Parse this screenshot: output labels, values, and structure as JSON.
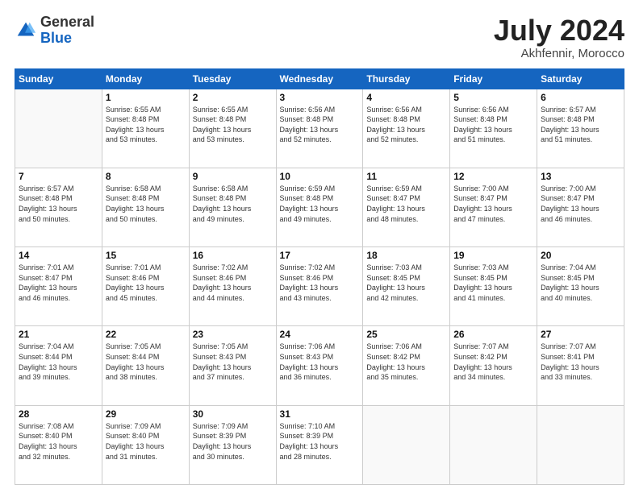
{
  "logo": {
    "general": "General",
    "blue": "Blue"
  },
  "header": {
    "month": "July 2024",
    "location": "Akhfennir, Morocco"
  },
  "days_of_week": [
    "Sunday",
    "Monday",
    "Tuesday",
    "Wednesday",
    "Thursday",
    "Friday",
    "Saturday"
  ],
  "weeks": [
    [
      {
        "day": "",
        "info": ""
      },
      {
        "day": "1",
        "info": "Sunrise: 6:55 AM\nSunset: 8:48 PM\nDaylight: 13 hours\nand 53 minutes."
      },
      {
        "day": "2",
        "info": "Sunrise: 6:55 AM\nSunset: 8:48 PM\nDaylight: 13 hours\nand 53 minutes."
      },
      {
        "day": "3",
        "info": "Sunrise: 6:56 AM\nSunset: 8:48 PM\nDaylight: 13 hours\nand 52 minutes."
      },
      {
        "day": "4",
        "info": "Sunrise: 6:56 AM\nSunset: 8:48 PM\nDaylight: 13 hours\nand 52 minutes."
      },
      {
        "day": "5",
        "info": "Sunrise: 6:56 AM\nSunset: 8:48 PM\nDaylight: 13 hours\nand 51 minutes."
      },
      {
        "day": "6",
        "info": "Sunrise: 6:57 AM\nSunset: 8:48 PM\nDaylight: 13 hours\nand 51 minutes."
      }
    ],
    [
      {
        "day": "7",
        "info": "Sunrise: 6:57 AM\nSunset: 8:48 PM\nDaylight: 13 hours\nand 50 minutes."
      },
      {
        "day": "8",
        "info": "Sunrise: 6:58 AM\nSunset: 8:48 PM\nDaylight: 13 hours\nand 50 minutes."
      },
      {
        "day": "9",
        "info": "Sunrise: 6:58 AM\nSunset: 8:48 PM\nDaylight: 13 hours\nand 49 minutes."
      },
      {
        "day": "10",
        "info": "Sunrise: 6:59 AM\nSunset: 8:48 PM\nDaylight: 13 hours\nand 49 minutes."
      },
      {
        "day": "11",
        "info": "Sunrise: 6:59 AM\nSunset: 8:47 PM\nDaylight: 13 hours\nand 48 minutes."
      },
      {
        "day": "12",
        "info": "Sunrise: 7:00 AM\nSunset: 8:47 PM\nDaylight: 13 hours\nand 47 minutes."
      },
      {
        "day": "13",
        "info": "Sunrise: 7:00 AM\nSunset: 8:47 PM\nDaylight: 13 hours\nand 46 minutes."
      }
    ],
    [
      {
        "day": "14",
        "info": "Sunrise: 7:01 AM\nSunset: 8:47 PM\nDaylight: 13 hours\nand 46 minutes."
      },
      {
        "day": "15",
        "info": "Sunrise: 7:01 AM\nSunset: 8:46 PM\nDaylight: 13 hours\nand 45 minutes."
      },
      {
        "day": "16",
        "info": "Sunrise: 7:02 AM\nSunset: 8:46 PM\nDaylight: 13 hours\nand 44 minutes."
      },
      {
        "day": "17",
        "info": "Sunrise: 7:02 AM\nSunset: 8:46 PM\nDaylight: 13 hours\nand 43 minutes."
      },
      {
        "day": "18",
        "info": "Sunrise: 7:03 AM\nSunset: 8:45 PM\nDaylight: 13 hours\nand 42 minutes."
      },
      {
        "day": "19",
        "info": "Sunrise: 7:03 AM\nSunset: 8:45 PM\nDaylight: 13 hours\nand 41 minutes."
      },
      {
        "day": "20",
        "info": "Sunrise: 7:04 AM\nSunset: 8:45 PM\nDaylight: 13 hours\nand 40 minutes."
      }
    ],
    [
      {
        "day": "21",
        "info": "Sunrise: 7:04 AM\nSunset: 8:44 PM\nDaylight: 13 hours\nand 39 minutes."
      },
      {
        "day": "22",
        "info": "Sunrise: 7:05 AM\nSunset: 8:44 PM\nDaylight: 13 hours\nand 38 minutes."
      },
      {
        "day": "23",
        "info": "Sunrise: 7:05 AM\nSunset: 8:43 PM\nDaylight: 13 hours\nand 37 minutes."
      },
      {
        "day": "24",
        "info": "Sunrise: 7:06 AM\nSunset: 8:43 PM\nDaylight: 13 hours\nand 36 minutes."
      },
      {
        "day": "25",
        "info": "Sunrise: 7:06 AM\nSunset: 8:42 PM\nDaylight: 13 hours\nand 35 minutes."
      },
      {
        "day": "26",
        "info": "Sunrise: 7:07 AM\nSunset: 8:42 PM\nDaylight: 13 hours\nand 34 minutes."
      },
      {
        "day": "27",
        "info": "Sunrise: 7:07 AM\nSunset: 8:41 PM\nDaylight: 13 hours\nand 33 minutes."
      }
    ],
    [
      {
        "day": "28",
        "info": "Sunrise: 7:08 AM\nSunset: 8:40 PM\nDaylight: 13 hours\nand 32 minutes."
      },
      {
        "day": "29",
        "info": "Sunrise: 7:09 AM\nSunset: 8:40 PM\nDaylight: 13 hours\nand 31 minutes."
      },
      {
        "day": "30",
        "info": "Sunrise: 7:09 AM\nSunset: 8:39 PM\nDaylight: 13 hours\nand 30 minutes."
      },
      {
        "day": "31",
        "info": "Sunrise: 7:10 AM\nSunset: 8:39 PM\nDaylight: 13 hours\nand 28 minutes."
      },
      {
        "day": "",
        "info": ""
      },
      {
        "day": "",
        "info": ""
      },
      {
        "day": "",
        "info": ""
      }
    ]
  ]
}
